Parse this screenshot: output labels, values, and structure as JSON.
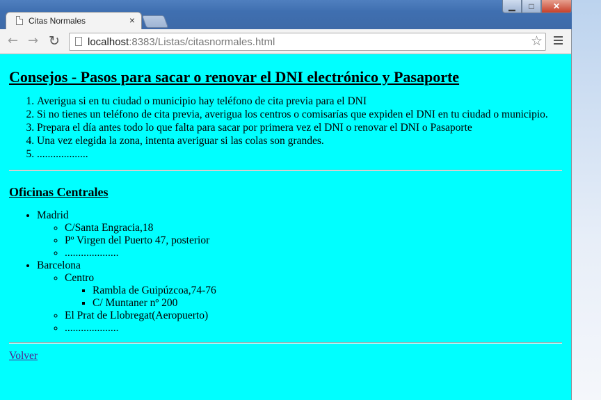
{
  "browser": {
    "tab_title": "Citas Normales",
    "tab_close": "×",
    "url_host": "localhost",
    "url_rest": ":8383/Listas/citasnormales.html"
  },
  "page": {
    "title": "Consejos - Pasos para sacar o renovar el DNI electrónico y Pasaporte",
    "tips": [
      "Averigua si en tu ciudad o municipio hay teléfono de cita previa para el DNI",
      "Si no tienes un teléfono de cita previa, averigua los centros o comisarías que expiden el DNI en tu ciudad o municipio.",
      "Prepara el día antes todo lo que falta para sacar por primera vez el DNI o renovar el DNI o Pasaporte",
      "Una vez elegida la zona, intenta averiguar si las colas son grandes.",
      "..................."
    ],
    "offices_title": "Oficinas Centrales",
    "offices": {
      "madrid": {
        "name": "Madrid",
        "items": [
          "C/Santa Engracia,18",
          "Pº Virgen del Puerto 47, posterior",
          "...................."
        ]
      },
      "barcelona": {
        "name": "Barcelona",
        "centro": "Centro",
        "centro_items": [
          "Rambla de Guipúzcoa,74-76",
          "C/ Muntaner nº 200"
        ],
        "items": [
          "El Prat de Llobregat(Aeropuerto)",
          "...................."
        ]
      }
    },
    "back_link": "Volver"
  },
  "colors": {
    "page_background": "#00ffff",
    "visited_link": "#551a8b"
  }
}
